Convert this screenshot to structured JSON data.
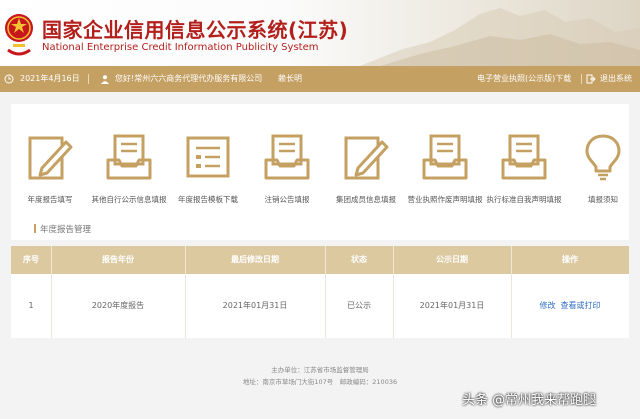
{
  "header": {
    "title_cn": "国家企业信用信息公示系统(江苏)",
    "title_en": "National Enterprise Credit Information Publicity System"
  },
  "topbar": {
    "date": "2021年4月16日",
    "greeting": "您好!常州六六商务代理代办服务有限公司",
    "user": "赖长明",
    "download_license": "电子营业执照(公示版)下载",
    "logout": "退出系统"
  },
  "tiles": [
    {
      "label": "年度报告填写",
      "icon": "edit-form-icon"
    },
    {
      "label": "其他自行公示信息填报",
      "icon": "inbox-tray-icon"
    },
    {
      "label": "年度报告模板下载",
      "icon": "template-document-icon"
    },
    {
      "label": "注销公告填报",
      "icon": "inbox-tray-icon"
    },
    {
      "label": "集团成员信息填报",
      "icon": "edit-form-icon"
    },
    {
      "label": "营业执照作废声明填报",
      "icon": "inbox-tray-icon"
    },
    {
      "label": "执行标准自我声明填报",
      "icon": "inbox-tray-icon"
    },
    {
      "label": "填报须知",
      "icon": "lightbulb-icon"
    }
  ],
  "section_title": "年度报告管理",
  "table": {
    "headers": [
      "序号",
      "报告年份",
      "最后修改日期",
      "状态",
      "公示日期",
      "操作"
    ],
    "rows": [
      {
        "no": "1",
        "year": "2020年度报告",
        "modified": "2021年01月31日",
        "status": "已公示",
        "published": "2021年01月31日",
        "action_edit": "修改",
        "action_view": "查看或打印"
      }
    ]
  },
  "footer": {
    "line1": "主办单位：江苏省市场监督管理局",
    "line2": "地址：南京市草场门大街107号　邮政编码：210036"
  },
  "watermark": "头条 @常州我来帮跑腿",
  "colors": {
    "brand_red": "#b3201c",
    "gold": "#c4a063",
    "table_header": "#dcc9a0",
    "link": "#2f6ec4"
  }
}
